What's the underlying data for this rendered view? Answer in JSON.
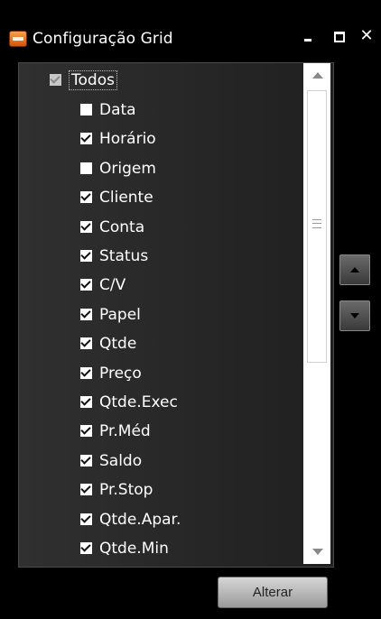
{
  "window": {
    "title": "Configuração Grid",
    "icons": {
      "app": "grid-app-icon",
      "minimize": "minimize-icon",
      "maximize": "maximize-icon",
      "close": "close-icon"
    },
    "close_glyph": "✕"
  },
  "list": {
    "todos": {
      "label": "Todos",
      "checked": true
    },
    "items": [
      {
        "label": "Data",
        "checked": false
      },
      {
        "label": "Horário",
        "checked": true
      },
      {
        "label": "Origem",
        "checked": false
      },
      {
        "label": "Cliente",
        "checked": true
      },
      {
        "label": "Conta",
        "checked": true
      },
      {
        "label": "Status",
        "checked": true
      },
      {
        "label": "C/V",
        "checked": true
      },
      {
        "label": "Papel",
        "checked": true
      },
      {
        "label": "Qtde",
        "checked": true
      },
      {
        "label": "Preço",
        "checked": true
      },
      {
        "label": "Qtde.Exec",
        "checked": true
      },
      {
        "label": "Pr.Méd",
        "checked": true
      },
      {
        "label": "Saldo",
        "checked": true
      },
      {
        "label": "Pr.Stop",
        "checked": true
      },
      {
        "label": "Qtde.Apar.",
        "checked": true
      },
      {
        "label": "Qtde.Min",
        "checked": true
      }
    ]
  },
  "side_buttons": {
    "up_icon": "move-up-icon",
    "down_icon": "move-down-icon"
  },
  "footer": {
    "apply_label": "Alterar"
  },
  "colors": {
    "background": "#000000",
    "panel": "#2a2a2a",
    "accent": "#e8782a"
  }
}
